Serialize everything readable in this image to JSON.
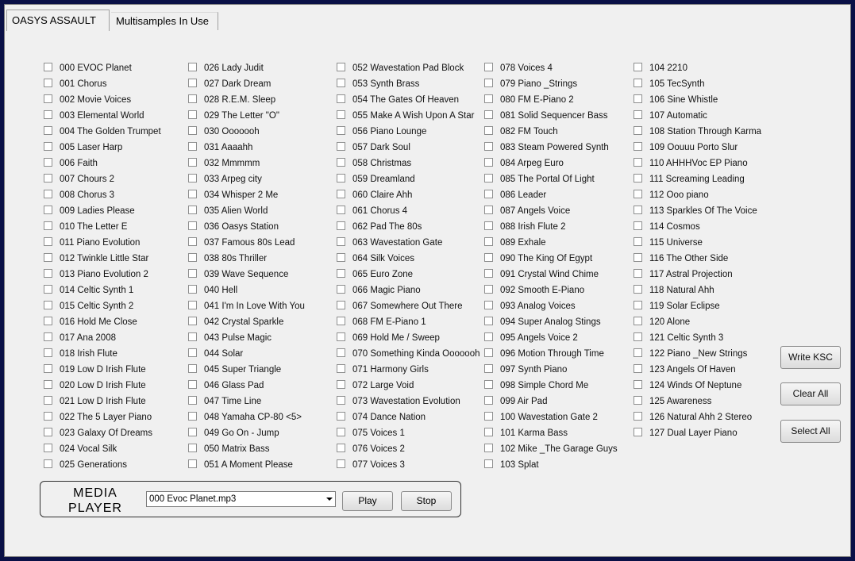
{
  "tabs": [
    {
      "label": "OASYS ASSAULT",
      "active": true
    },
    {
      "label": "Multisamples In Use",
      "active": false
    }
  ],
  "programs": [
    "000 EVOC Planet",
    "001 Chorus",
    "002 Movie Voices",
    "003 Elemental World",
    "004 The Golden Trumpet",
    "005 Laser Harp",
    "006 Faith",
    "007 Chours 2",
    "008 Chorus 3",
    "009 Ladies Please",
    "010 The Letter E",
    "011 Piano Evolution",
    "012 Twinkle Little Star",
    "013 Piano Evolution 2",
    "014 Celtic Synth 1",
    "015 Celtic Synth 2",
    "016 Hold Me Close",
    "017 Ana 2008",
    "018 Irish Flute",
    "019 Low D Irish Flute",
    "020 Low D Irish Flute",
    "021 Low D Irish Flute",
    "022 The 5 Layer Piano",
    "023 Galaxy Of Dreams",
    "024 Vocal Silk",
    "025 Generations",
    "026 Lady Judit",
    "027 Dark Dream",
    "028 R.E.M. Sleep",
    "029 The Letter \"O\"",
    "030 Ooooooh",
    "031 Aaaahh",
    "032 Mmmmm",
    "033 Arpeg city",
    "034 Whisper 2 Me",
    "035 Alien World",
    "036 Oasys Station",
    "037 Famous 80s Lead",
    "038 80s Thriller",
    "039 Wave Sequence",
    "040 Hell",
    "041 I'm In Love With You",
    "042 Crystal Sparkle",
    "043 Pulse Magic",
    "044 Solar",
    "045 Super Triangle",
    "046 Glass Pad",
    "047 Time Line",
    "048 Yamaha CP-80 <5>",
    "049 Go On - Jump",
    "050 Matrix Bass",
    "051 A Moment Please",
    "052 Wavestation Pad Block",
    "053 Synth Brass",
    "054 The Gates Of Heaven",
    "055 Make A Wish Upon A Star",
    "056 Piano Lounge",
    "057 Dark Soul",
    "058 Christmas",
    "059 Dreamland",
    "060 Claire Ahh",
    "061 Chorus 4",
    "062 Pad The 80s",
    "063 Wavestation Gate",
    "064 Silk Voices",
    "065 Euro Zone",
    "066 Magic Piano",
    "067 Somewhere Out There",
    "068 FM E-Piano 1",
    "069 Hold Me / Sweep",
    "070 Something Kinda Ooooooh",
    "071 Harmony Girls",
    "072 Large Void",
    "073 Wavestation Evolution",
    "074 Dance Nation",
    "075 Voices 1",
    "076 Voices 2",
    "077 Voices 3",
    "078 Voices 4",
    "079 Piano _Strings",
    "080 FM E-Piano 2",
    "081 Solid Sequencer Bass",
    "082 FM Touch",
    "083 Steam Powered Synth",
    "084 Arpeg Euro",
    "085 The Portal Of Light",
    "086 Leader",
    "087 Angels Voice",
    "088 Irish Flute 2",
    "089 Exhale",
    "090 The King Of Egypt",
    "091 Crystal Wind Chime",
    "092 Smooth E-Piano",
    "093 Analog Voices",
    "094 Super Analog Stings",
    "095 Angels Voice 2",
    "096 Motion Through Time",
    "097 Synth Piano",
    "098 Simple Chord Me",
    "099 Air Pad",
    "100 Wavestation Gate 2",
    "101 Karma Bass",
    "102 Mike _The Garage Guys",
    "103 Splat",
    "104 2210",
    "105 TecSynth",
    "106 Sine Whistle",
    "107 Automatic",
    "108 Station Through Karma",
    "109 Oouuu Porto Slur",
    "110 AHHHVoc EP Piano",
    "111 Screaming Leading",
    "112 Ooo piano",
    "113 Sparkles Of The Voice",
    "114 Cosmos",
    "115 Universe",
    "116 The Other Side",
    "117 Astral Projection",
    "118 Natural Ahh",
    "119 Solar Eclipse",
    "120 Alone",
    "121 Celtic Synth 3",
    "122 Piano _New Strings",
    "123 Angels Of Haven",
    "124 Winds Of Neptune",
    "125 Awareness",
    "126 Natural Ahh 2 Stereo",
    "127 Dual Layer Piano"
  ],
  "columns": [
    {
      "start": 0,
      "count": 26
    },
    {
      "start": 26,
      "count": 26
    },
    {
      "start": 52,
      "count": 26
    },
    {
      "start": 78,
      "count": 26
    },
    {
      "start": 104,
      "count": 24
    }
  ],
  "buttons": {
    "write_ksc": "Write KSC",
    "clear_all": "Clear All",
    "select_all": "Select All"
  },
  "media_player": {
    "title_line1": "MEDIA",
    "title_line2": "PLAYER",
    "selected_file": "000 Evoc Planet.mp3",
    "play_label": "Play",
    "stop_label": "Stop"
  }
}
